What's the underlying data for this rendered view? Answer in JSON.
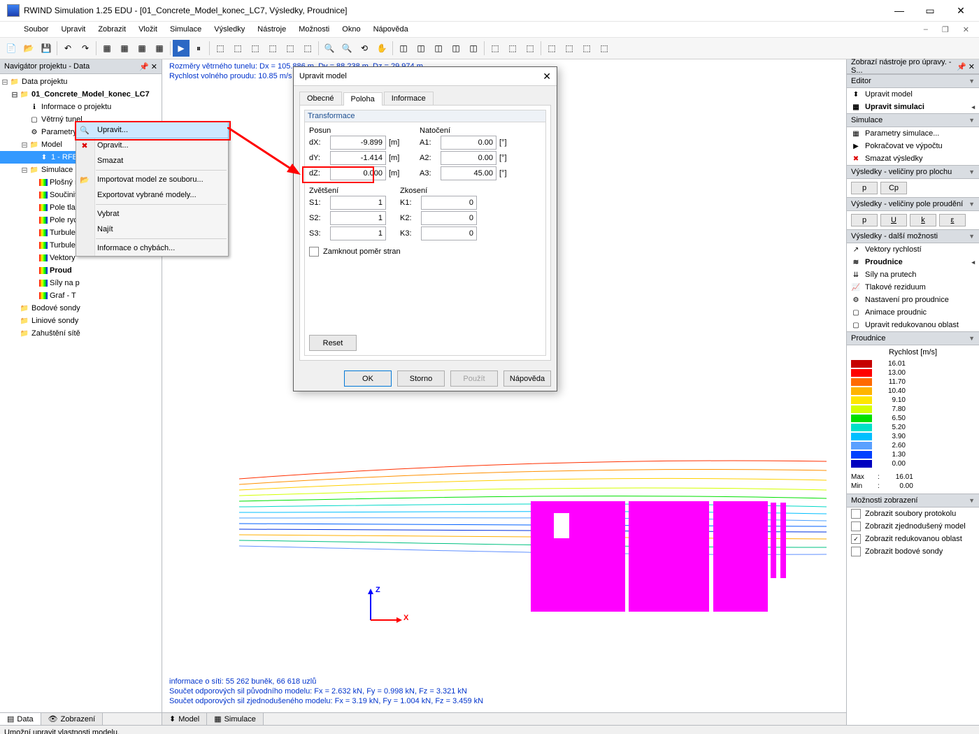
{
  "window": {
    "title": "RWIND Simulation 1.25 EDU - [01_Concrete_Model_konec_LC7, Výsledky, Proudnice]",
    "min": "—",
    "max": "▭",
    "close": "✕"
  },
  "menu": [
    "Soubor",
    "Upravit",
    "Zobrazit",
    "Vložit",
    "Simulace",
    "Výsledky",
    "Nástroje",
    "Možnosti",
    "Okno",
    "Nápověda"
  ],
  "navigator": {
    "title": "Navigátor projektu - Data",
    "root": "Data projektu",
    "project": "01_Concrete_Model_konec_LC7",
    "items": [
      "Informace o projektu",
      "Větrný tunel",
      "Parametry simulace"
    ],
    "model_label": "Model",
    "model_sel": "1 - RFE",
    "sim_label": "Simulace",
    "sim_items": [
      "Plošný r",
      "Součinit",
      "Pole tla",
      "Pole ryc",
      "Turbule",
      "Turbule",
      "Vektory"
    ],
    "sim_bold": "Proud",
    "sim_after": [
      "Síly na p",
      "Graf - T"
    ],
    "after": [
      "Bodové sondy",
      "Liniové sondy",
      "Zahuštění sítě"
    ],
    "tabs": {
      "data": "Data",
      "zobrazeni": "Zobrazení"
    }
  },
  "ctx": {
    "upravit": "Upravit...",
    "opravit": "Opravit...",
    "smazat": "Smazat",
    "import": "Importovat model ze souboru...",
    "export": "Exportovat vybrané modely...",
    "vybrat": "Vybrat",
    "najit": "Najít",
    "chyby": "Informace o chybách..."
  },
  "dialog": {
    "title": "Upravit model",
    "tabs": {
      "obecne": "Obecné",
      "poloha": "Poloha",
      "informace": "Informace"
    },
    "group": "Transformace",
    "posun": "Posun",
    "natoceni": "Natočení",
    "zvetseni": "Zvětšení",
    "zkoseni": "Zkosení",
    "dx": {
      "label": "dX:",
      "value": "-9.899",
      "unit": "[m]"
    },
    "dy": {
      "label": "dY:",
      "value": "-1.414",
      "unit": "[m]"
    },
    "dz": {
      "label": "dZ:",
      "value": "0.000",
      "unit": "[m]"
    },
    "a1": {
      "label": "A1:",
      "value": "0.00",
      "unit": "[°]"
    },
    "a2": {
      "label": "A2:",
      "value": "0.00",
      "unit": "[°]"
    },
    "a3": {
      "label": "A3:",
      "value": "45.00",
      "unit": "[°]"
    },
    "s1": {
      "label": "S1:",
      "value": "1"
    },
    "s2": {
      "label": "S2:",
      "value": "1"
    },
    "s3": {
      "label": "S3:",
      "value": "1"
    },
    "k1": {
      "label": "K1:",
      "value": "0"
    },
    "k2": {
      "label": "K2:",
      "value": "0"
    },
    "k3": {
      "label": "K3:",
      "value": "0"
    },
    "lock": "Zamknout poměr stran",
    "reset": "Reset",
    "ok": "OK",
    "storno": "Storno",
    "pouzit": "Použít",
    "napoveda": "Nápověda"
  },
  "viewport": {
    "line1": "Rozměry větrného tunelu: Dx = 105.886 m, Dy = 88.238 m, Dz = 29.974 m",
    "line2": "Rychlost volného proudu: 10.85 m/s",
    "foot1": "informace o síti: 55 262 buněk, 66 618 uzlů",
    "foot2": "Součet odporových sil původního modelu: Fx = 2.632 kN, Fy = 0.998 kN, Fz = 3.321 kN",
    "foot3": "Součet odporových sil zjednodušeného modelu: Fx = 3.19 kN, Fy = 1.004 kN, Fz = 3.459 kN",
    "axis_z": "Z",
    "axis_x": "X",
    "tabs": {
      "model": "Model",
      "simulace": "Simulace"
    }
  },
  "right": {
    "header": "Zobrazí nástroje pro úpravy. - S...",
    "editor": "Editor",
    "upravit_model": "Upravit model",
    "upravit_sim": "Upravit simulaci",
    "simulace": "Simulace",
    "param": "Parametry simulace...",
    "pokr": "Pokračovat ve výpočtu",
    "smaz": "Smazat výsledky",
    "vys_plocha": "Výsledky - veličiny pro plochu",
    "btn_p": "p",
    "btn_cp": "Cp",
    "vys_pole": "Výsledky - veličiny pole proudění",
    "btn_p2": "p",
    "btn_u": "U",
    "btn_k": "k",
    "btn_e": "ε",
    "vys_dalsi": "Výsledky - další možnosti",
    "vektory": "Vektory rychlostí",
    "proudnice": "Proudnice",
    "sily": "Síly na prutech",
    "tlak": "Tlakové reziduum",
    "nastaveni": "Nastavení pro proudnice",
    "animace": "Animace proudnic",
    "reduk": "Upravit redukovanou oblast",
    "proudnice_grp": "Proudnice",
    "legend_title": "Rychlost [m/s]",
    "legend": [
      {
        "c": "#c60000",
        "v": "16.01"
      },
      {
        "c": "#ff0000",
        "v": "13.00"
      },
      {
        "c": "#ff6a00",
        "v": "11.70"
      },
      {
        "c": "#ffb400",
        "v": "10.40"
      },
      {
        "c": "#ffe600",
        "v": "9.10"
      },
      {
        "c": "#d4ff00",
        "v": "7.80"
      },
      {
        "c": "#00e000",
        "v": "6.50"
      },
      {
        "c": "#00e0c8",
        "v": "5.20"
      },
      {
        "c": "#00bfff",
        "v": "3.90"
      },
      {
        "c": "#5aa0ff",
        "v": "2.60"
      },
      {
        "c": "#0040ff",
        "v": "1.30"
      },
      {
        "c": "#0000c0",
        "v": "0.00"
      }
    ],
    "max_lbl": "Max",
    "max_val": "16.01",
    "min_lbl": "Min",
    "min_val": "0.00",
    "moznosti": "Možnosti zobrazení",
    "chk1": "Zobrazit soubory protokolu",
    "chk2": "Zobrazit zjednodušený model",
    "chk3": "Zobrazit redukovanou oblast",
    "chk4": "Zobrazit bodové sondy"
  },
  "status": "Umožní upravit vlastnosti modelu."
}
